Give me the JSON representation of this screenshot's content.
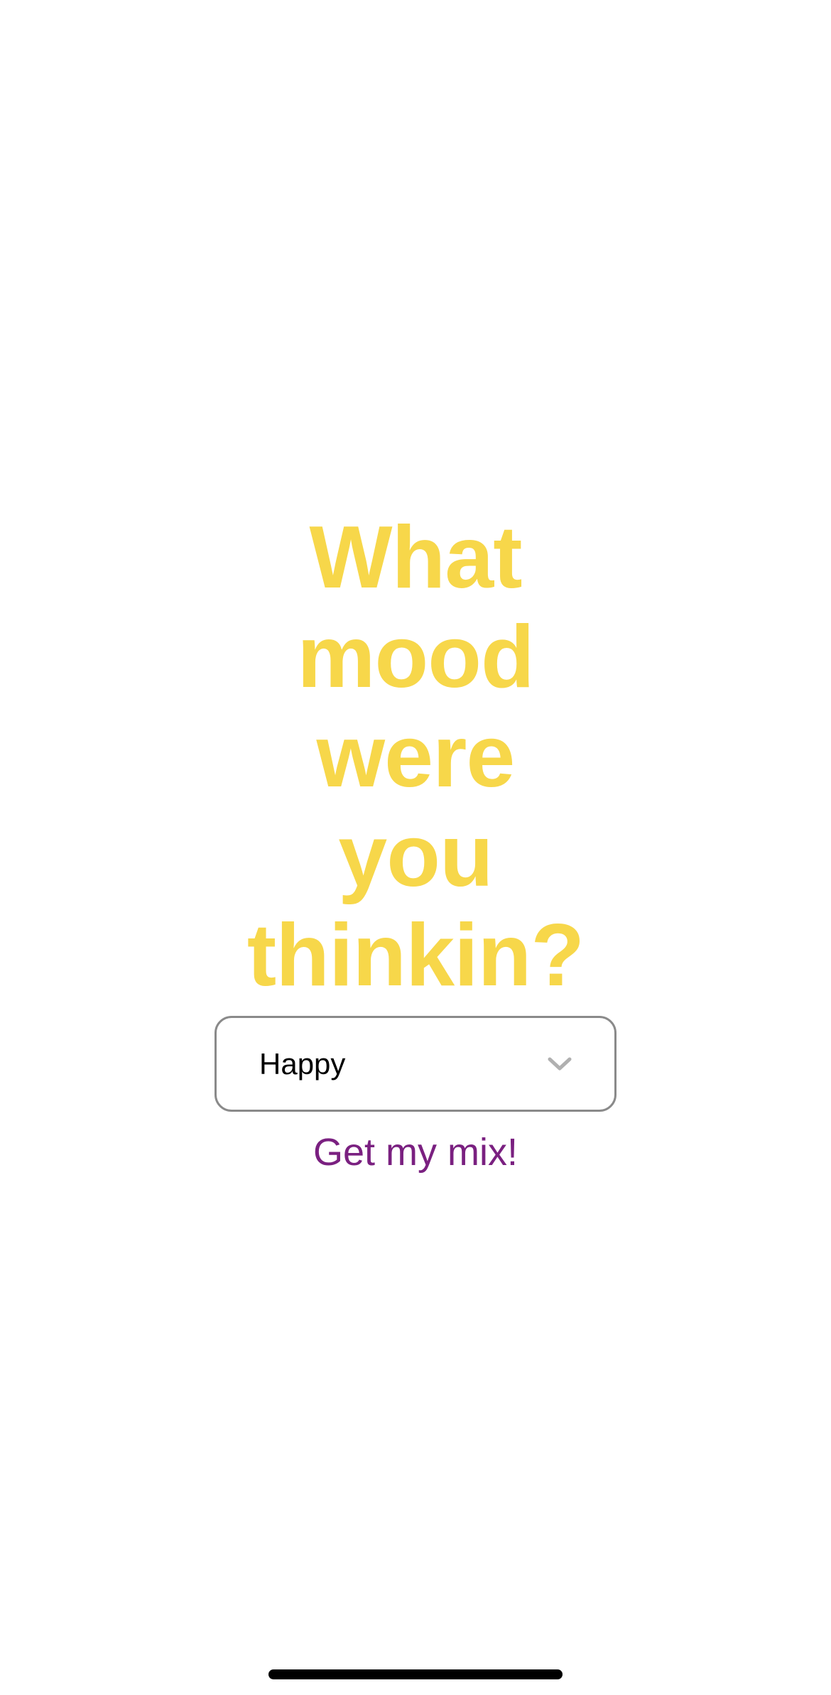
{
  "colors": {
    "background": "#ffffff",
    "headline": "#F7D74A",
    "cta": "#7A2080",
    "select_border": "#8a8a8a",
    "chevron": "#b0b0b0"
  },
  "main": {
    "headline": "What mood were you thinkin?",
    "mood_select": {
      "selected_value": "Happy",
      "icon": "chevron-down-icon"
    },
    "cta_label": "Get my mix!"
  }
}
